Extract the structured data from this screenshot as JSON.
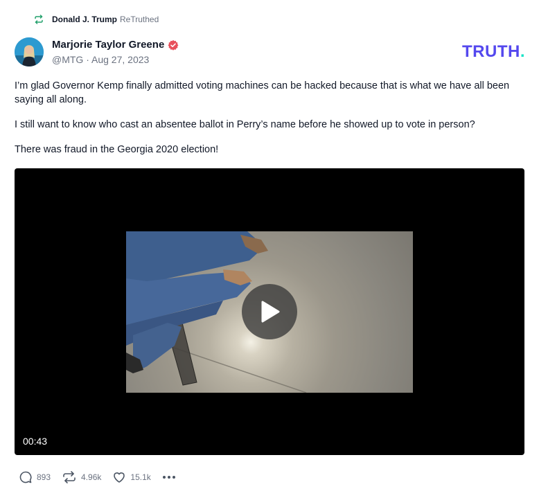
{
  "retruth": {
    "name": "Donald J. Trump",
    "suffix": "ReTruthed",
    "icon": "retruth-icon"
  },
  "author": {
    "name": "Marjorie Taylor Greene",
    "handle": "@MTG",
    "date": "Aug 27, 2023",
    "verified_icon": "verified-badge-icon"
  },
  "brand": {
    "logo_text": "TRUTH",
    "logo_dot": ".",
    "color": "#5448ee",
    "dot_color": "#17e3c7"
  },
  "post": {
    "paragraphs": [
      "I’m glad Governor Kemp finally admitted voting machines can be hacked because that is what we have all been saying all along.",
      "I still want to know who cast an absentee ballot in Perry’s name before he showed up to vote in person?",
      "There was fraud in the Georgia 2020 election!"
    ]
  },
  "video": {
    "duration": "00:43",
    "play_icon": "play-icon"
  },
  "actions": {
    "replies": "893",
    "retruths": "4.96k",
    "likes": "15.1k",
    "more_icon": "more-icon"
  }
}
